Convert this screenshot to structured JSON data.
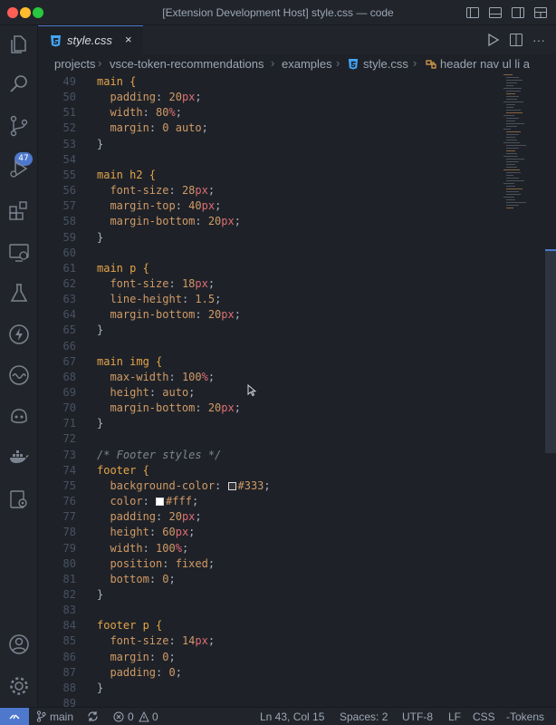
{
  "window": {
    "title": "[Extension Development Host] style.css — code"
  },
  "activity_bar": {
    "items": [
      "explorer-icon",
      "search-icon",
      "source-control-icon",
      "run-debug-icon",
      "extensions-icon",
      "remote-explorer-icon",
      "testing-icon",
      "lightning-icon",
      "wave-icon",
      "copilot-icon",
      "docker-icon",
      "settings-sync-icon"
    ],
    "scm_badge": "47",
    "bottom_items": [
      "account-icon",
      "gear-icon"
    ]
  },
  "tab": {
    "label": "style.css",
    "close": "×"
  },
  "breadcrumb": {
    "items": [
      "projects",
      "vsce-token-recommendations",
      "examples",
      "style.css",
      "header nav ul li a"
    ],
    "separator": "›"
  },
  "editor": {
    "lines": [
      {
        "n": "49",
        "t": "sel",
        "text": "main {"
      },
      {
        "n": "50",
        "t": "decl",
        "prop": "padding",
        "parts": [
          [
            "num",
            "20"
          ],
          [
            "unit",
            "px"
          ]
        ]
      },
      {
        "n": "51",
        "t": "decl",
        "prop": "width",
        "parts": [
          [
            "num",
            "80"
          ],
          [
            "unit",
            "%"
          ]
        ]
      },
      {
        "n": "52",
        "t": "decl",
        "prop": "margin",
        "parts": [
          [
            "num",
            "0"
          ],
          [
            "punc",
            " "
          ],
          [
            "val",
            "auto"
          ]
        ]
      },
      {
        "n": "53",
        "t": "close",
        "text": "}"
      },
      {
        "n": "54",
        "t": "blank",
        "text": ""
      },
      {
        "n": "55",
        "t": "sel",
        "text": "main h2 {"
      },
      {
        "n": "56",
        "t": "decl",
        "prop": "font-size",
        "parts": [
          [
            "num",
            "28"
          ],
          [
            "unit",
            "px"
          ]
        ]
      },
      {
        "n": "57",
        "t": "decl",
        "prop": "margin-top",
        "parts": [
          [
            "num",
            "40"
          ],
          [
            "unit",
            "px"
          ]
        ]
      },
      {
        "n": "58",
        "t": "decl",
        "prop": "margin-bottom",
        "parts": [
          [
            "num",
            "20"
          ],
          [
            "unit",
            "px"
          ]
        ]
      },
      {
        "n": "59",
        "t": "close",
        "text": "}"
      },
      {
        "n": "60",
        "t": "blank",
        "text": ""
      },
      {
        "n": "61",
        "t": "sel",
        "text": "main p {"
      },
      {
        "n": "62",
        "t": "decl",
        "prop": "font-size",
        "parts": [
          [
            "num",
            "18"
          ],
          [
            "unit",
            "px"
          ]
        ]
      },
      {
        "n": "63",
        "t": "decl",
        "prop": "line-height",
        "parts": [
          [
            "num",
            "1.5"
          ]
        ]
      },
      {
        "n": "64",
        "t": "decl",
        "prop": "margin-bottom",
        "parts": [
          [
            "num",
            "20"
          ],
          [
            "unit",
            "px"
          ]
        ]
      },
      {
        "n": "65",
        "t": "close",
        "text": "}"
      },
      {
        "n": "66",
        "t": "blank",
        "text": ""
      },
      {
        "n": "67",
        "t": "sel",
        "text": "main img {"
      },
      {
        "n": "68",
        "t": "decl",
        "prop": "max-width",
        "parts": [
          [
            "num",
            "100"
          ],
          [
            "unit",
            "%"
          ]
        ]
      },
      {
        "n": "69",
        "t": "decl",
        "prop": "height",
        "parts": [
          [
            "val",
            "auto"
          ]
        ]
      },
      {
        "n": "70",
        "t": "decl",
        "prop": "margin-bottom",
        "parts": [
          [
            "num",
            "20"
          ],
          [
            "unit",
            "px"
          ]
        ]
      },
      {
        "n": "71",
        "t": "close",
        "text": "}"
      },
      {
        "n": "72",
        "t": "blank",
        "text": ""
      },
      {
        "n": "73",
        "t": "cmt",
        "text": "/* Footer styles */"
      },
      {
        "n": "74",
        "t": "sel",
        "text": "footer {"
      },
      {
        "n": "75",
        "t": "decl",
        "prop": "background-color",
        "swatch": "#333333",
        "parts": [
          [
            "val",
            "#333"
          ]
        ]
      },
      {
        "n": "76",
        "t": "decl",
        "prop": "color",
        "swatch": "#ffffff",
        "parts": [
          [
            "val",
            "#fff"
          ]
        ]
      },
      {
        "n": "77",
        "t": "decl",
        "prop": "padding",
        "parts": [
          [
            "num",
            "20"
          ],
          [
            "unit",
            "px"
          ]
        ]
      },
      {
        "n": "78",
        "t": "decl",
        "prop": "height",
        "parts": [
          [
            "num",
            "60"
          ],
          [
            "unit",
            "px"
          ]
        ]
      },
      {
        "n": "79",
        "t": "decl",
        "prop": "width",
        "parts": [
          [
            "num",
            "100"
          ],
          [
            "unit",
            "%"
          ]
        ]
      },
      {
        "n": "80",
        "t": "decl",
        "prop": "position",
        "parts": [
          [
            "val",
            "fixed"
          ]
        ]
      },
      {
        "n": "81",
        "t": "decl",
        "prop": "bottom",
        "parts": [
          [
            "num",
            "0"
          ]
        ]
      },
      {
        "n": "82",
        "t": "close",
        "text": "}"
      },
      {
        "n": "83",
        "t": "blank",
        "text": ""
      },
      {
        "n": "84",
        "t": "sel",
        "text": "footer p {"
      },
      {
        "n": "85",
        "t": "decl",
        "prop": "font-size",
        "parts": [
          [
            "num",
            "14"
          ],
          [
            "unit",
            "px"
          ]
        ]
      },
      {
        "n": "86",
        "t": "decl",
        "prop": "margin",
        "parts": [
          [
            "num",
            "0"
          ]
        ]
      },
      {
        "n": "87",
        "t": "decl",
        "prop": "padding",
        "parts": [
          [
            "num",
            "0"
          ]
        ]
      },
      {
        "n": "88",
        "t": "close",
        "text": "}"
      },
      {
        "n": "89",
        "t": "blank",
        "text": ""
      }
    ]
  },
  "status_bar": {
    "branch": "main",
    "errors": "0",
    "warnings": "0",
    "cursor_position": "Ln 43, Col 15",
    "indentation": "Spaces: 2",
    "encoding": "UTF-8",
    "eol": "LF",
    "language": "CSS",
    "extra": "-Tokens"
  },
  "colors": {
    "accent": "#4d78cc",
    "background": "#1e2228",
    "sidebar": "#21252b",
    "selector": "#e5a34a",
    "number": "#d19a66",
    "unit": "#e06c75"
  }
}
